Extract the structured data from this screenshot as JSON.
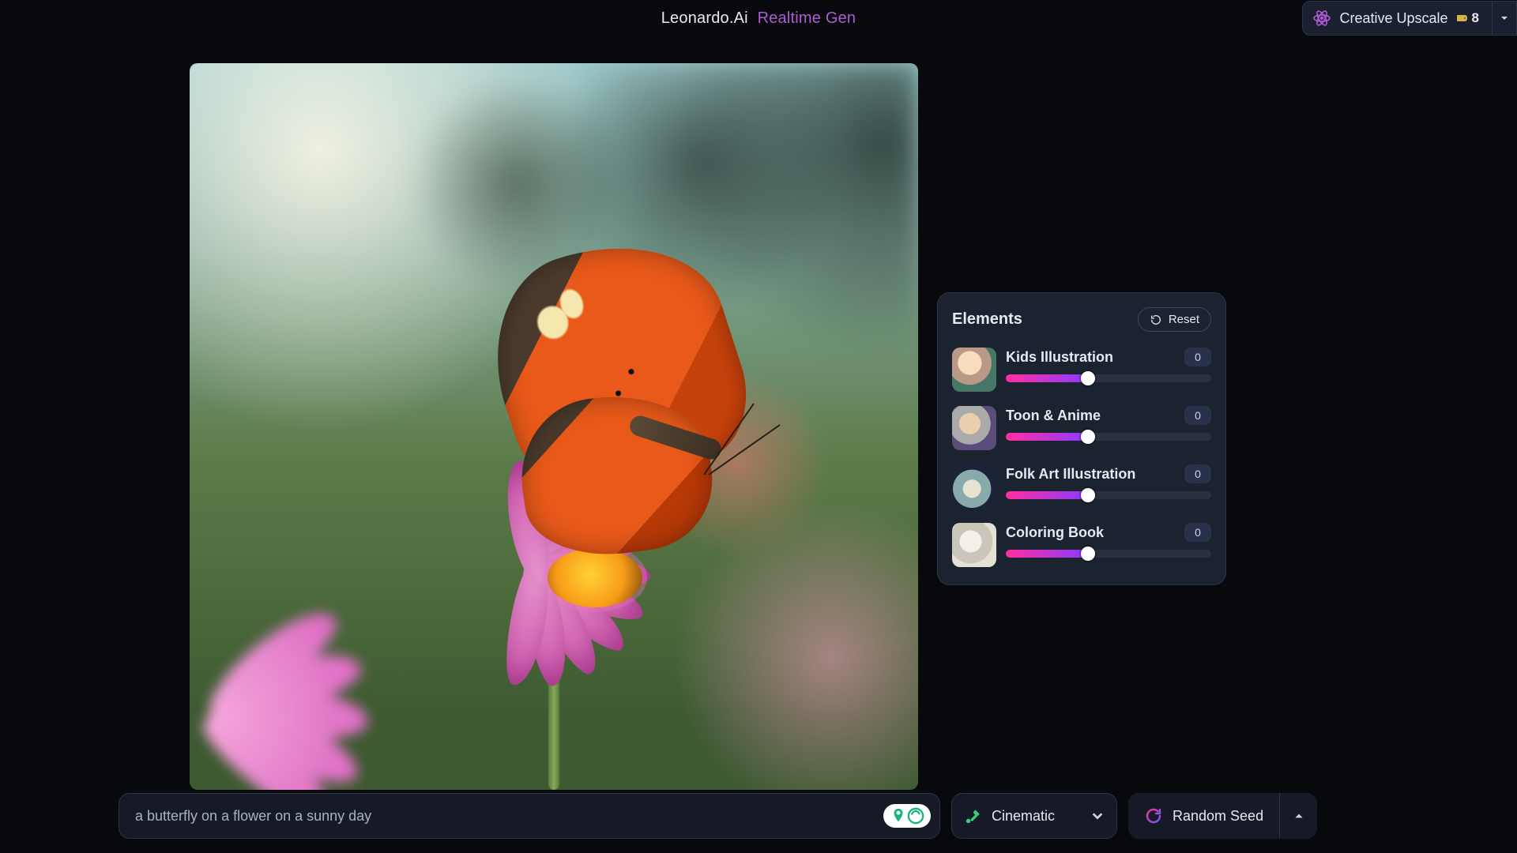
{
  "header": {
    "brand": "Leonardo.Ai",
    "mode": "Realtime Gen",
    "upscale_label": "Creative Upscale",
    "credits": "8"
  },
  "elements_panel": {
    "title": "Elements",
    "reset_label": "Reset",
    "items": [
      {
        "name": "Kids Illustration",
        "value": "0",
        "slider_pct": 40,
        "thumb_class": "kids"
      },
      {
        "name": "Toon & Anime",
        "value": "0",
        "slider_pct": 40,
        "thumb_class": "toon"
      },
      {
        "name": "Folk Art Illustration",
        "value": "0",
        "slider_pct": 40,
        "thumb_class": "folk"
      },
      {
        "name": "Coloring Book",
        "value": "0",
        "slider_pct": 40,
        "thumb_class": "color"
      }
    ]
  },
  "bottom": {
    "prompt_value": "a butterfly on a flower on a sunny day",
    "style_label": "Cinematic",
    "seed_label": "Random Seed"
  },
  "colors": {
    "grad_start": "#ff2fa0",
    "grad_end": "#8a3bff"
  }
}
